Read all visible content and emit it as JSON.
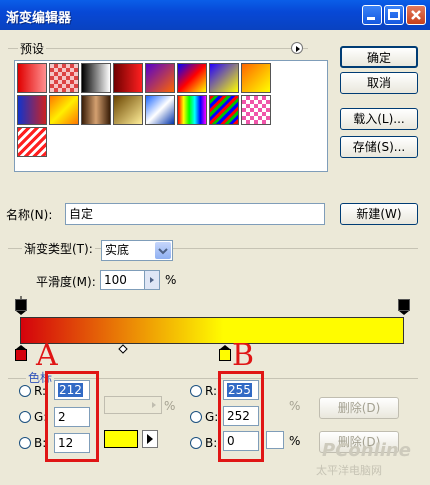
{
  "window": {
    "title": "渐变编辑器"
  },
  "presets": {
    "label": "预设",
    "gradients": [
      "linear-gradient(90deg,#e00000,#ff9090)",
      "repeating-conic-gradient(#d44 0 25%,#f5c6c6 0 50%) 0 0/8px 8px",
      "linear-gradient(90deg,#000,#fff)",
      "linear-gradient(90deg,#700000,#ff2020)",
      "linear-gradient(135deg,#5500cc,#ff6600)",
      "linear-gradient(135deg,#0000ff,#ff0000,#ffff00)",
      "linear-gradient(135deg,#2200ff,#ffff00)",
      "linear-gradient(135deg,#ff6600,#ffff00)",
      "linear-gradient(90deg,#1133cc,#cc2222)",
      "linear-gradient(135deg,#ff7700,#ffee00,#ff7700)",
      "linear-gradient(90deg,#3a1e08,#d4a070,#3a1e08)",
      "linear-gradient(135deg,#6a4400,#ffee99)",
      "linear-gradient(135deg,#1a66ff,#ffffff,#0033aa)",
      "linear-gradient(90deg,#ff0000,#ffff00,#00ff00,#00ffff,#0000ff,#ff00ff)",
      "repeating-linear-gradient(135deg,#ff0000 0 3px,#00c000 3px 6px,#0000ff 6px 9px)",
      "repeating-conic-gradient(#f055aa 0 25%,#ffffff 0 50%) 0 0/8px 8px",
      "repeating-linear-gradient(135deg,#ff2020 0 3px,#ffffff 3px 6px)"
    ]
  },
  "buttons": {
    "ok": "确定",
    "cancel": "取消",
    "load": "载入(L)...",
    "save": "存储(S)...",
    "new": "新建(W)"
  },
  "name": {
    "label": "名称(N):",
    "value": "自定"
  },
  "gradient_type": {
    "label": "渐变类型(T):",
    "value": "实底"
  },
  "smoothness": {
    "label": "平滑度(M):",
    "value": "100",
    "unit": "%"
  },
  "gradient_bar": {
    "start_color": "#d4020c",
    "end_color": "#fffc00",
    "midpoint": 0.5
  },
  "stops_group": {
    "label": "色标"
  },
  "left_panel": {
    "r_label": "R:",
    "r_value": "212",
    "g_label": "G:",
    "g_value": "2",
    "b_label": "B:",
    "b_value": "12",
    "opacity_unit": "%",
    "swatch_color": "#ffff00"
  },
  "right_panel": {
    "r_label": "R:",
    "r_value": "255",
    "g_label": "G:",
    "g_value": "252",
    "b_label": "B:",
    "b_value": "0",
    "percent": "%",
    "delete1": "删除(D)",
    "delete2": "删除(D)"
  },
  "annotations": {
    "a": "A",
    "b": "B"
  },
  "watermark": {
    "text1": "PConline",
    "text2": "太平洋电脑网"
  },
  "colors": {
    "accent_red": "#e01515",
    "xp_blue": "#0a5ee8"
  }
}
